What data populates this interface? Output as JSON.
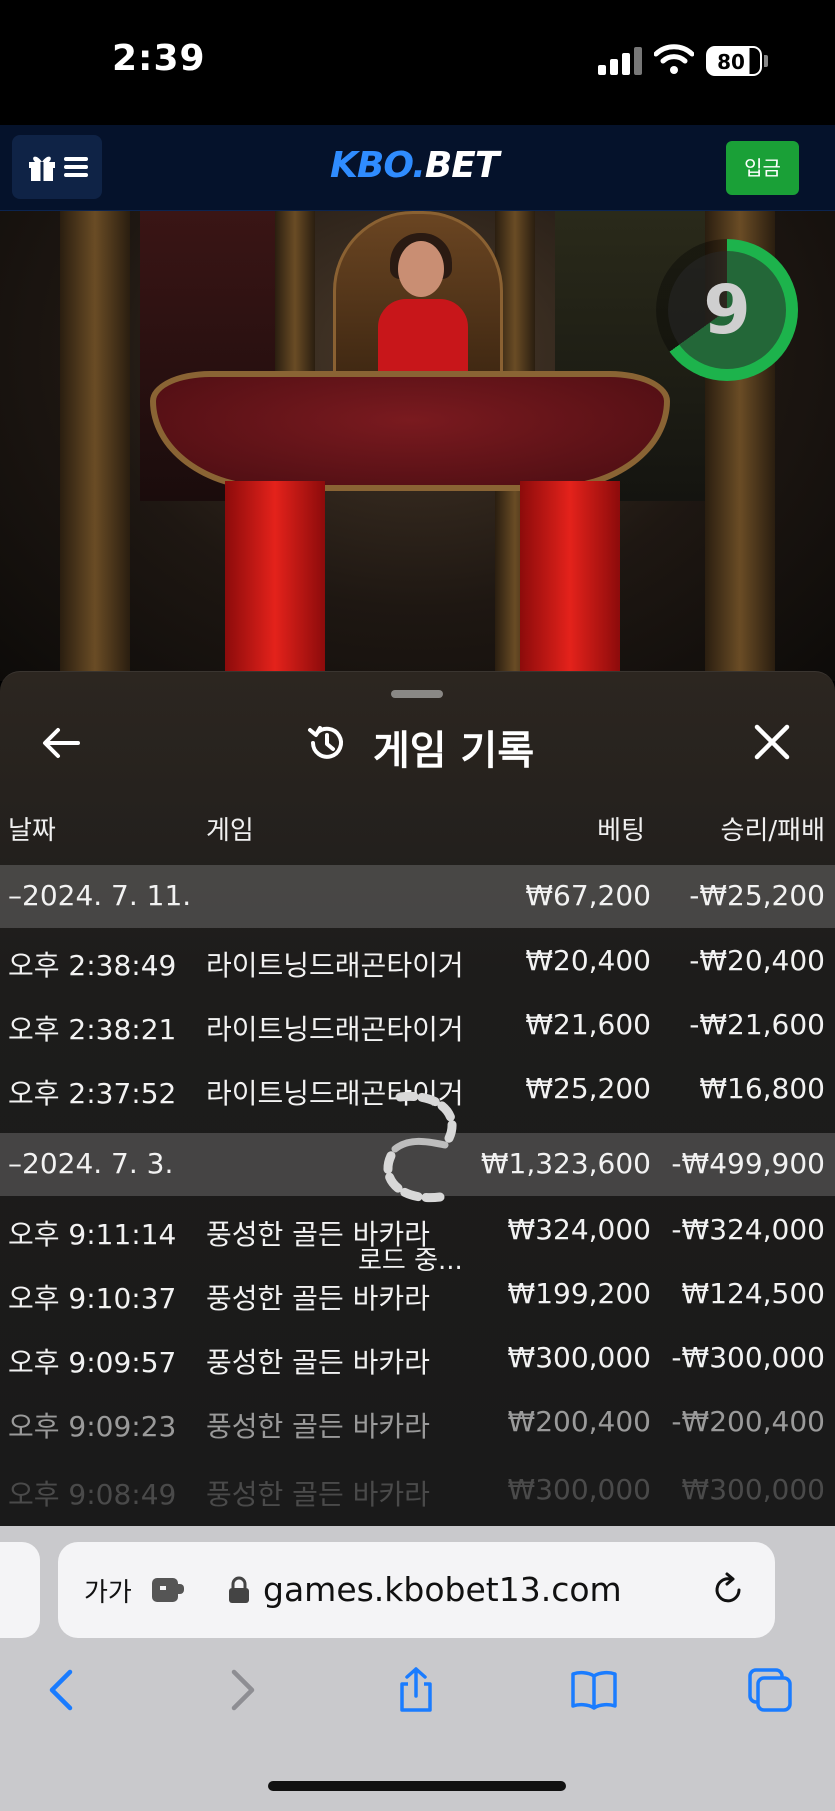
{
  "status_bar": {
    "time": "2:39",
    "battery": "80"
  },
  "header": {
    "logo_part1": "KBO.",
    "logo_part2": "BET",
    "deposit_label": "입금"
  },
  "game": {
    "timer": "9",
    "timer_color": "#1db34c"
  },
  "history": {
    "title": "게임 기록",
    "columns": {
      "date": "날짜",
      "game": "게임",
      "bet": "베팅",
      "result": "승리/패배"
    },
    "rows": [
      {
        "date": "–2024. 7. 11.",
        "game": "",
        "bet": "₩67,200",
        "result": "-₩25,200"
      },
      {
        "date": "오후 2:38:49",
        "game": "라이트닝드래곤타이거",
        "bet": "₩20,400",
        "result": "-₩20,400"
      },
      {
        "date": "오후 2:38:21",
        "game": "라이트닝드래곤타이거",
        "bet": "₩21,600",
        "result": "-₩21,600"
      },
      {
        "date": "오후 2:37:52",
        "game": "라이트닝드래곤타이거",
        "bet": "₩25,200",
        "result": "₩16,800"
      },
      {
        "date": "–2024. 7. 3.",
        "game": "",
        "bet": "₩1,323,600",
        "result": "-₩499,900"
      },
      {
        "date": "오후 9:11:14",
        "game": "풍성한 골든 바카라",
        "bet": "₩324,000",
        "result": "-₩324,000"
      },
      {
        "date": "오후 9:10:37",
        "game": "풍성한 골든 바카라",
        "bet": "₩199,200",
        "result": "₩124,500"
      },
      {
        "date": "오후 9:09:57",
        "game": "풍성한 골든 바카라",
        "bet": "₩300,000",
        "result": "-₩300,000"
      },
      {
        "date": "오후 9:09:23",
        "game": "풍성한 골든 바카라",
        "bet": "₩200,400",
        "result": "-₩200,400"
      },
      {
        "date": "오후 9:08:49",
        "game": "풍성한 골든 바카라",
        "bet": "₩300,000",
        "result": "₩300,000"
      }
    ],
    "loading_text": "로드 중..."
  },
  "browser": {
    "aa_label": "가가",
    "url": "games.kbobet13.com",
    "accent": "#1a7cff"
  }
}
